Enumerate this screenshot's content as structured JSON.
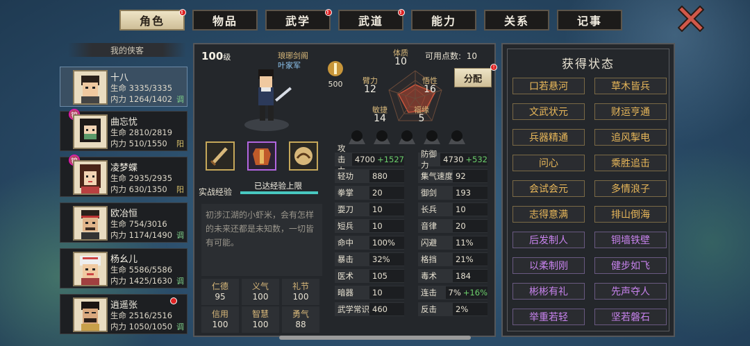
{
  "tabs": [
    {
      "label": "角色",
      "active": true,
      "dot": true
    },
    {
      "label": "物品",
      "active": false,
      "dot": false
    },
    {
      "label": "武学",
      "active": false,
      "dot": true
    },
    {
      "label": "武道",
      "active": false,
      "dot": true
    },
    {
      "label": "能力",
      "active": false,
      "dot": false
    },
    {
      "label": "关系",
      "active": false,
      "dot": false
    },
    {
      "label": "记事",
      "active": false,
      "dot": false
    }
  ],
  "list_title": "我的侠客",
  "characters": [
    {
      "name": "十八",
      "hp": "生命 3335/3335",
      "mp": "内力 1264/1402",
      "tag": "调",
      "tag_color": "g",
      "badge": "",
      "red": false,
      "selected": true
    },
    {
      "name": "曲忘忧",
      "hp": "生命 2810/2819",
      "mp": "内力 510/1550",
      "tag": "阳",
      "tag_color": "y",
      "badge": "锦",
      "red": false,
      "selected": false
    },
    {
      "name": "凌梦蝶",
      "hp": "生命 2935/2935",
      "mp": "内力 630/1350",
      "tag": "阳",
      "tag_color": "y",
      "badge": "锦",
      "red": false,
      "selected": false
    },
    {
      "name": "欧冶恒",
      "hp": "生命 754/3016",
      "mp": "内力 1174/1490",
      "tag": "调",
      "tag_color": "g",
      "badge": "",
      "red": false,
      "selected": false
    },
    {
      "name": "杨幺儿",
      "hp": "生命 5586/5586",
      "mp": "内力 1425/1630",
      "tag": "调",
      "tag_color": "g",
      "badge": "",
      "red": false,
      "selected": false
    },
    {
      "name": "逍遥张",
      "hp": "生命 2516/2516",
      "mp": "内力 1050/1050",
      "tag": "调",
      "tag_color": "g",
      "badge": "",
      "red": true,
      "selected": false
    }
  ],
  "hero": {
    "level": "100",
    "level_unit": "级",
    "sect": "琅琊剑阁",
    "faction": "叶家军",
    "xp_label": "实战经验",
    "xp_text": "已达经验上限",
    "xp_fraction": 1.0,
    "desc": "初涉江湖的小虾米，会有怎样的未来还都是未知数，一切皆有可能。",
    "potential": "500"
  },
  "virtues": [
    {
      "k": "仁德",
      "v": "95"
    },
    {
      "k": "义气",
      "v": "100"
    },
    {
      "k": "礼节",
      "v": "100"
    },
    {
      "k": "信用",
      "v": "100"
    },
    {
      "k": "智慧",
      "v": "100"
    },
    {
      "k": "勇气",
      "v": "88"
    }
  ],
  "points": {
    "label": "可用点数:",
    "value": "10",
    "alloc": "分配"
  },
  "attributes": [
    {
      "k": "体质",
      "v": "10"
    },
    {
      "k": "臂力",
      "v": "12"
    },
    {
      "k": "悟性",
      "v": "16"
    },
    {
      "k": "敏捷",
      "v": "14"
    },
    {
      "k": "福缘",
      "v": "5"
    }
  ],
  "stats_left": [
    {
      "k": "攻击力",
      "v": "4700",
      "g": "+1527"
    },
    {
      "k": "轻功",
      "v": "880",
      "g": ""
    },
    {
      "k": "拳掌",
      "v": "20",
      "g": ""
    },
    {
      "k": "耍刀",
      "v": "10",
      "g": ""
    },
    {
      "k": "短兵",
      "v": "10",
      "g": ""
    },
    {
      "k": "命中",
      "v": "100%",
      "g": ""
    },
    {
      "k": "暴击",
      "v": "32%",
      "g": ""
    },
    {
      "k": "医术",
      "v": "105",
      "g": ""
    },
    {
      "k": "暗器",
      "v": "10",
      "g": ""
    },
    {
      "k": "武学常识",
      "v": "460",
      "g": ""
    }
  ],
  "stats_right": [
    {
      "k": "防御力",
      "v": "4730",
      "g": "+532"
    },
    {
      "k": "集气速度",
      "v": "92",
      "g": ""
    },
    {
      "k": "御剑",
      "v": "193",
      "g": ""
    },
    {
      "k": "长兵",
      "v": "10",
      "g": ""
    },
    {
      "k": "音律",
      "v": "20",
      "g": ""
    },
    {
      "k": "闪避",
      "v": "11%",
      "g": ""
    },
    {
      "k": "格挡",
      "v": "21%",
      "g": ""
    },
    {
      "k": "毒术",
      "v": "184",
      "g": ""
    },
    {
      "k": "连击",
      "v": "7%",
      "g": "+16%"
    },
    {
      "k": "反击",
      "v": "2%",
      "g": ""
    }
  ],
  "status": {
    "title": "获得状态",
    "items": [
      {
        "l": "口若悬河",
        "c": "o"
      },
      {
        "l": "草木皆兵",
        "c": "o"
      },
      {
        "l": "文武状元",
        "c": "o"
      },
      {
        "l": "财运亨通",
        "c": "o"
      },
      {
        "l": "兵器精通",
        "c": "o"
      },
      {
        "l": "追风掣电",
        "c": "o"
      },
      {
        "l": "问心",
        "c": "o"
      },
      {
        "l": "乘胜追击",
        "c": "o"
      },
      {
        "l": "会试会元",
        "c": "o"
      },
      {
        "l": "多情浪子",
        "c": "o"
      },
      {
        "l": "志得意满",
        "c": "o"
      },
      {
        "l": "排山倒海",
        "c": "o"
      },
      {
        "l": "后发制人",
        "c": "p"
      },
      {
        "l": "铜墙铁壁",
        "c": "p"
      },
      {
        "l": "以柔制刚",
        "c": "p"
      },
      {
        "l": "健步如飞",
        "c": "p"
      },
      {
        "l": "彬彬有礼",
        "c": "p"
      },
      {
        "l": "先声夺人",
        "c": "p"
      },
      {
        "l": "举重若轻",
        "c": "p"
      },
      {
        "l": "坚若磐石",
        "c": "p"
      }
    ]
  }
}
